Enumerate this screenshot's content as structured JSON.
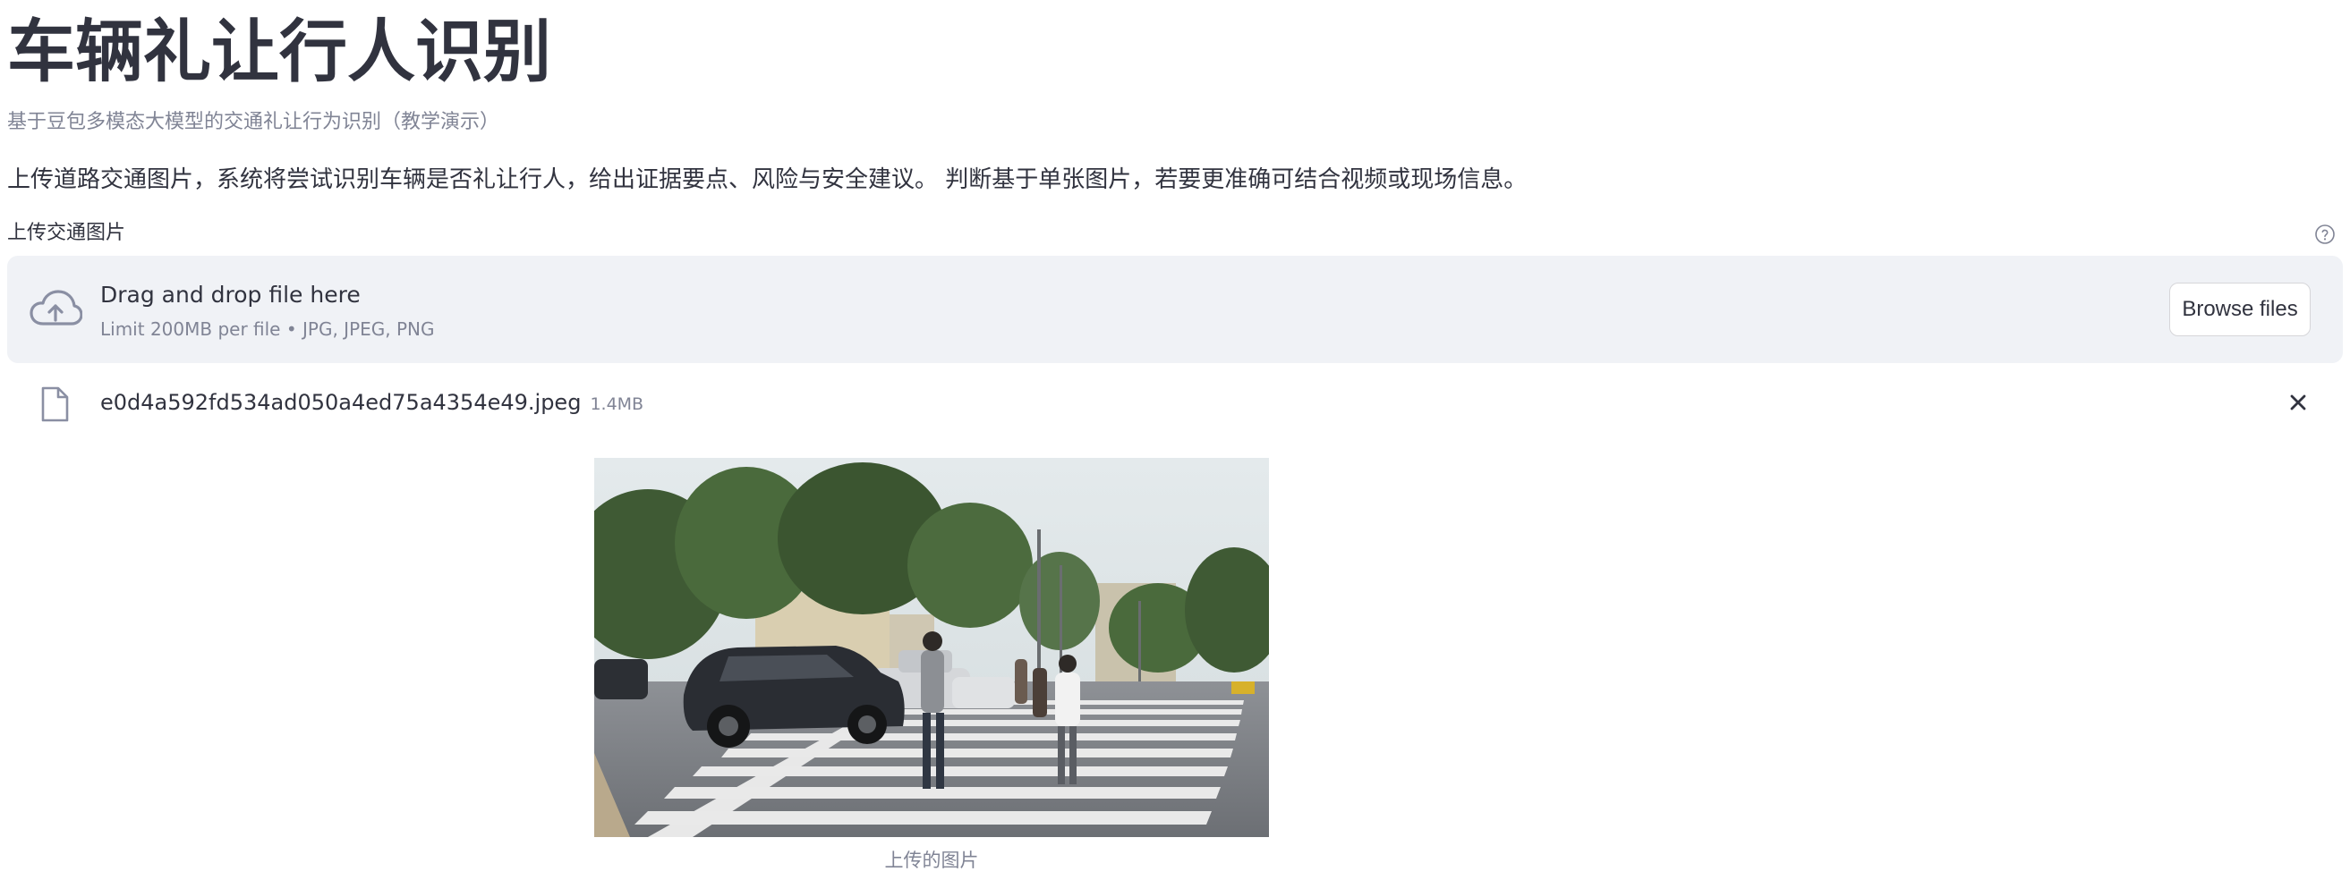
{
  "header": {
    "title": "车辆礼让行人识别",
    "subtitle": "基于豆包多模态大模型的交通礼让行为识别（教学演示）",
    "description": "上传道路交通图片，系统将尝试识别车辆是否礼让行人，给出证据要点、风险与安全建议。 判断基于单张图片，若要更准确可结合视频或现场信息。"
  },
  "uploader": {
    "label": "上传交通图片",
    "help_icon": "help-circle-icon",
    "dropzone": {
      "icon": "cloud-upload-icon",
      "title": "Drag and drop file here",
      "limit": "Limit 200MB per file • JPG, JPEG, PNG",
      "browse_label": "Browse files"
    },
    "file": {
      "icon": "file-icon",
      "name": "e0d4a592fd534ad050a4ed75a4354e49.jpeg",
      "size": "1.4MB",
      "remove_icon": "close-icon"
    }
  },
  "image": {
    "caption": "上传的图片"
  },
  "colors": {
    "text": "#31333f",
    "muted": "#808495",
    "dropzone_bg": "#f0f2f6",
    "border": "#d6d6d9"
  }
}
